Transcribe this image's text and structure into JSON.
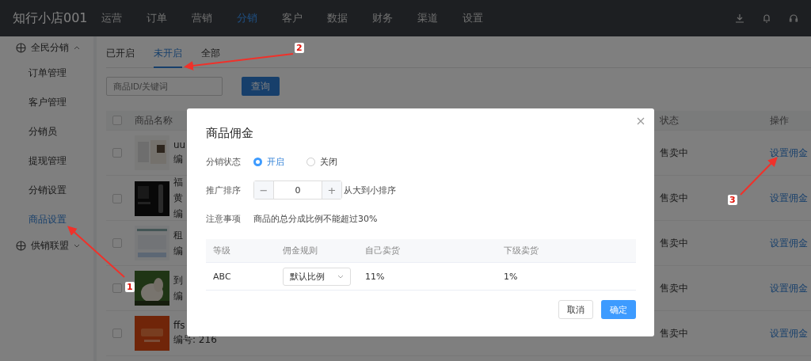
{
  "nav": {
    "logo": "知行小店001",
    "items": [
      {
        "label": "运营",
        "selected": false
      },
      {
        "label": "订单",
        "selected": false
      },
      {
        "label": "营销",
        "selected": false
      },
      {
        "label": "分销",
        "selected": true
      },
      {
        "label": "客户",
        "selected": false
      },
      {
        "label": "数据",
        "selected": false
      },
      {
        "label": "财务",
        "selected": false
      },
      {
        "label": "渠道",
        "selected": false
      },
      {
        "label": "设置",
        "selected": false
      }
    ]
  },
  "sidebar": {
    "groups": [
      {
        "label": "全民分销",
        "expanded": true,
        "items": [
          {
            "label": "订单管理",
            "selected": false
          },
          {
            "label": "客户管理",
            "selected": false
          },
          {
            "label": "分销员",
            "selected": false
          },
          {
            "label": "提现管理",
            "selected": false
          },
          {
            "label": "分销设置",
            "selected": false
          },
          {
            "label": "商品设置",
            "selected": true
          }
        ]
      },
      {
        "label": "供销联盟",
        "expanded": false
      }
    ]
  },
  "tabs": [
    {
      "label": "已开启",
      "selected": false
    },
    {
      "label": "未开启",
      "selected": true
    },
    {
      "label": "全部",
      "selected": false
    }
  ],
  "search": {
    "placeholder": "商品ID/关键词",
    "button": "查询"
  },
  "table": {
    "header_checked": false,
    "columns": [
      "商品名称",
      "状态",
      "操作"
    ],
    "rows": [
      {
        "checked": false,
        "name": "uu",
        "code": "编",
        "status": "售卖中",
        "action": "设置佣金"
      },
      {
        "checked": false,
        "name": "福",
        "subtitle": "黄",
        "code": "编",
        "status": "售卖中",
        "action": "设置佣金"
      },
      {
        "checked": false,
        "name": "租",
        "code": "编",
        "status": "售卖中",
        "action": "设置佣金"
      },
      {
        "checked": false,
        "name": "到",
        "code": "编",
        "status": "售卖中",
        "action": "设置佣金"
      },
      {
        "checked": false,
        "name": "ffs",
        "code": "编号: 216",
        "status": "售卖中",
        "action": "设置佣金"
      }
    ]
  },
  "modal": {
    "title": "商品佣金",
    "status_label": "分销状态",
    "status_options": [
      {
        "label": "开启",
        "selected": true
      },
      {
        "label": "关闭",
        "selected": false
      }
    ],
    "sort_label": "推广排序",
    "sort_value": "0",
    "sort_hint": "从大到小排序",
    "minus": "−",
    "plus": "+",
    "note_label": "注意事项",
    "note": "商品的总分成比例不能超过30%",
    "columns": [
      "等级",
      "佣金规则",
      "自己卖货",
      "下级卖货"
    ],
    "rows": [
      {
        "level": "ABC",
        "rule": "默认比例",
        "self": "11%",
        "sub": "1%"
      }
    ],
    "cancel": "取消",
    "confirm": "确定"
  },
  "annotations": [
    {
      "number": "1"
    },
    {
      "number": "2"
    },
    {
      "number": "3"
    }
  ]
}
